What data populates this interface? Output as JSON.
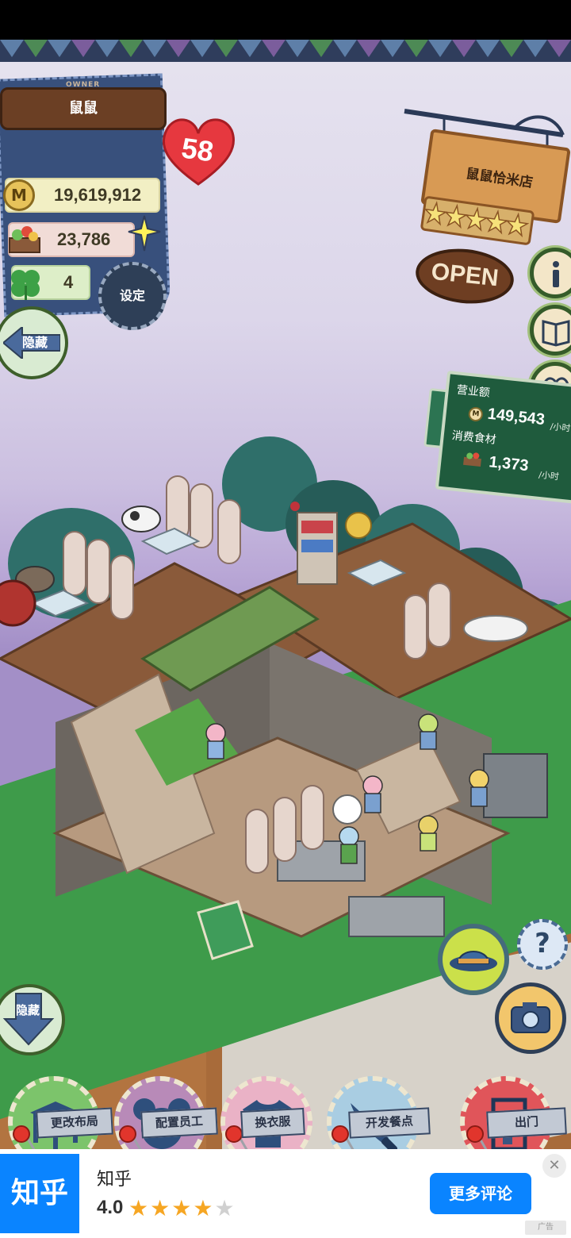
{
  "owner": {
    "label": "OWNER",
    "name": "鼠鼠",
    "level": "58"
  },
  "stats": {
    "money": "19,619,912",
    "food": "23,786",
    "clover": "4"
  },
  "buttons": {
    "settings": "设定",
    "hide_top": "隐藏",
    "hide_bottom": "隐藏",
    "help": "?"
  },
  "shop": {
    "name": "鼠鼠恰米店",
    "open_label": "OPEN",
    "stars": 5
  },
  "revenue": {
    "title": "营业额",
    "revenue_value": "149,543",
    "revenue_unit": "/小时",
    "food_title": "消费食材",
    "food_value": "1,373",
    "food_unit": "/小时"
  },
  "menu": [
    {
      "label": "更改布局",
      "icon": "table-icon",
      "color": "#7cc46b"
    },
    {
      "label": "配置员工",
      "icon": "mouse-head-icon",
      "color": "#b88ab8"
    },
    {
      "label": "换衣服",
      "icon": "shirt-icon",
      "color": "#eab2c6"
    },
    {
      "label": "开发餐点",
      "icon": "knife-icon",
      "color": "#a9cde2"
    },
    {
      "label": "出门",
      "icon": "door-icon",
      "color": "#e0555a"
    }
  ],
  "ad": {
    "logo": "知乎",
    "app_name": "知乎",
    "rating": "4.0",
    "stars_filled": 4,
    "stars_total": 5,
    "cta": "更多评论",
    "close": "✕",
    "tag": "广告"
  }
}
